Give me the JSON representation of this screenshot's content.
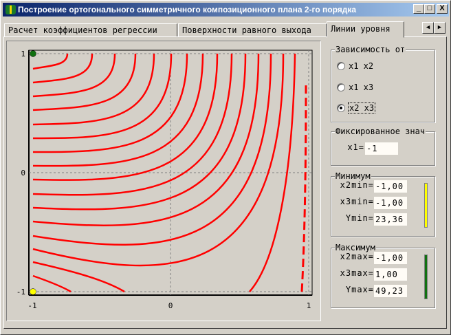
{
  "window": {
    "title": "Построение ортогонального симметричного композиционного плана 2-го порядка",
    "minimize": "_",
    "maximize": "□",
    "close": "X"
  },
  "tabs": [
    {
      "label": "Расчет коэффициентов регрессии"
    },
    {
      "label": "Поверхности равного выхода"
    },
    {
      "label": "Линии уровня"
    }
  ],
  "tab_scroll": {
    "left": "◀",
    "right": "▶"
  },
  "plot": {
    "x_ticks": [
      "-1",
      "0",
      "1"
    ],
    "y_ticks": [
      "1",
      "0",
      "-1"
    ],
    "max_marker_color": "#107010",
    "min_marker_color": "#ffff00",
    "line_color": "#ff0000"
  },
  "dependency": {
    "caption": "Зависимость от",
    "options": [
      "x1 x2",
      "x1 x3",
      "x2 x3"
    ],
    "selected": "x2 x3"
  },
  "fixed": {
    "caption": "Фиксированное знач",
    "label": "x1=",
    "value": "-1"
  },
  "minimum": {
    "caption": "Минимум",
    "rows": [
      {
        "label": "x2min=",
        "value": "-1,00"
      },
      {
        "label": "x3min=",
        "value": "-1,00"
      },
      {
        "label": "Ymin=",
        "value": "23,36"
      }
    ],
    "color": "#ffff00"
  },
  "maximum": {
    "caption": "Максимум",
    "rows": [
      {
        "label": "x2max=",
        "value": "-1,00"
      },
      {
        "label": "x3max=",
        "value": "1,00"
      },
      {
        "label": "Ymax=",
        "value": "49,23"
      }
    ],
    "color": "#107010"
  }
}
